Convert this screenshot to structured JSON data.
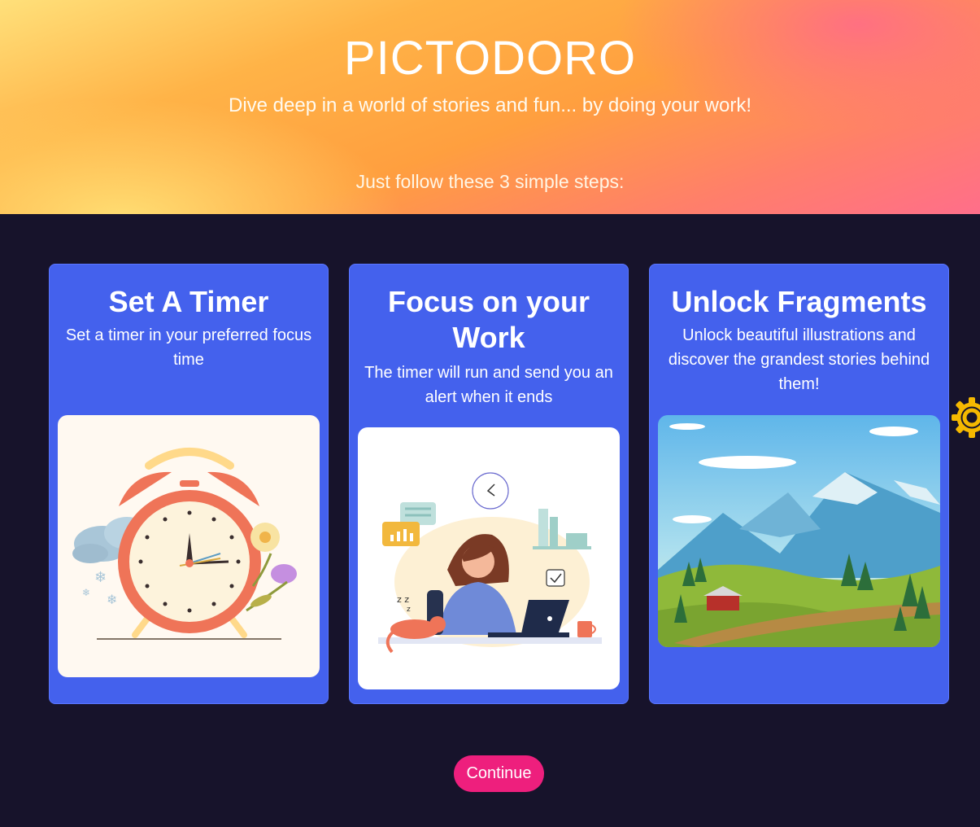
{
  "hero": {
    "title": "PICTODORO",
    "subtitle": "Dive deep in a world of stories and fun... by doing your work!",
    "steps_intro": "Just follow these 3 simple steps:"
  },
  "cards": [
    {
      "title": "Set A Timer",
      "description": "Set a timer in your preferred focus time",
      "illustration": "alarm-clock-illustration"
    },
    {
      "title": "Focus on your Work",
      "description": "The timer will run and send you an alert when it ends",
      "illustration": "person-working-at-laptop-illustration"
    },
    {
      "title": "Unlock Fragments",
      "description": "Unlock beautiful illustrations and discover the grandest stories behind them!",
      "illustration": "mountain-landscape-illustration"
    }
  ],
  "actions": {
    "continue_label": "Continue"
  },
  "icons": {
    "settings": "gear-icon"
  },
  "colors": {
    "background": "#17132b",
    "card": "#4461ed",
    "button": "#ee1f7d",
    "gear": "#f5b800"
  }
}
